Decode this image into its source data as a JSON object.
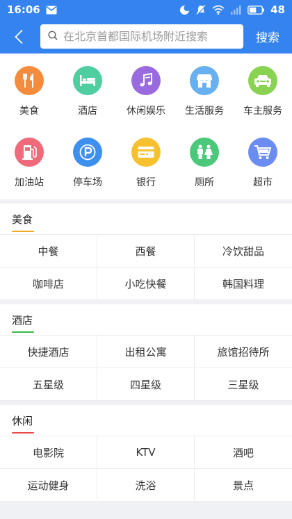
{
  "status": {
    "time": "16:06",
    "battery": "48"
  },
  "search": {
    "placeholder": "在北京首都国际机场附近搜索",
    "button": "搜索"
  },
  "colors": {
    "header": "#3483ee"
  },
  "categories": [
    {
      "label": "美食",
      "icon": "food-icon",
      "color": "#f58c3d"
    },
    {
      "label": "酒店",
      "icon": "bed-icon",
      "color": "#4fcea0"
    },
    {
      "label": "休闲娱乐",
      "icon": "music-note-icon",
      "color": "#9a6bde"
    },
    {
      "label": "生活服务",
      "icon": "shop-icon",
      "color": "#68b0ef"
    },
    {
      "label": "车主服务",
      "icon": "car-icon",
      "color": "#8ad352"
    },
    {
      "label": "加油站",
      "icon": "gas-station-icon",
      "color": "#f06a7c"
    },
    {
      "label": "停车场",
      "icon": "parking-icon",
      "color": "#3d8ff0"
    },
    {
      "label": "银行",
      "icon": "card-icon",
      "color": "#f6c02f"
    },
    {
      "label": "厕所",
      "icon": "restroom-icon",
      "color": "#4cc87a"
    },
    {
      "label": "超市",
      "icon": "cart-icon",
      "color": "#6b8cf0"
    }
  ],
  "sections": [
    {
      "title": "美食",
      "accent": "#f5a623",
      "items": [
        "中餐",
        "西餐",
        "冷饮甜品",
        "咖啡店",
        "小吃快餐",
        "韩国料理"
      ]
    },
    {
      "title": "酒店",
      "accent": "#3cb64c",
      "items": [
        "快捷酒店",
        "出租公寓",
        "旅馆招待所",
        "五星级",
        "四星级",
        "三星级"
      ]
    },
    {
      "title": "休闲",
      "accent": "#e94a4a",
      "items": [
        "电影院",
        "KTV",
        "酒吧",
        "运动健身",
        "洗浴",
        "景点"
      ]
    }
  ]
}
